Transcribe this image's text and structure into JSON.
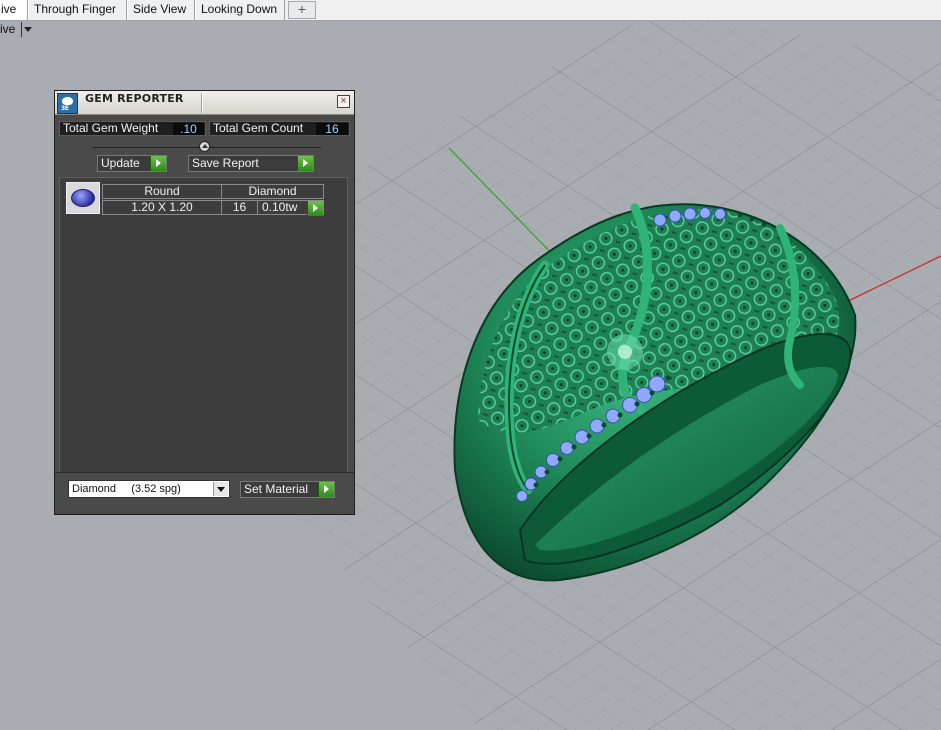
{
  "tabs": [
    {
      "label": "ive",
      "active": true
    },
    {
      "label": "Through Finger",
      "active": false
    },
    {
      "label": "Side View",
      "active": false
    },
    {
      "label": "Looking Down",
      "active": false
    }
  ],
  "viewport_label": "ive",
  "panel": {
    "title": "GEM REPORTER",
    "logo_text": "3E",
    "total_weight_label": "Total Gem Weight",
    "total_weight_value": ".10",
    "total_count_label": "Total Gem Count",
    "total_count_value": "16",
    "update_label": "Update",
    "save_report_label": "Save Report",
    "gem_row": {
      "shape": "Round",
      "material": "Diamond",
      "size": "1.20 X 1.20",
      "count": "16",
      "weight": "0.10tw"
    },
    "material_select": "Diamond     (3.52 spg)",
    "set_material_label": "Set Material"
  },
  "colors": {
    "background": "#a9adb1",
    "panel": "#4a4a4a",
    "ring_metal": "#1e8a5a",
    "gem_blue": "#8fa9ff",
    "axis_green": "#3aa03a",
    "axis_red": "#c83232"
  }
}
